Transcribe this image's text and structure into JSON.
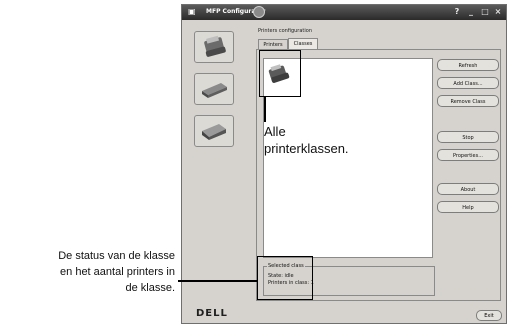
{
  "window": {
    "title": "MFP Configurator",
    "controls": [
      "?",
      "_",
      "□",
      "×"
    ]
  },
  "group": {
    "label": "Printers configuration"
  },
  "tabs": [
    {
      "label": "Printers",
      "active": false
    },
    {
      "label": "Classes",
      "active": true
    }
  ],
  "side_buttons": [
    {
      "icon": "printer-icon"
    },
    {
      "icon": "scanner-icon"
    },
    {
      "icon": "port-icon"
    }
  ],
  "buttons": {
    "refresh": "Refresh",
    "add_class": "Add Class...",
    "remove_class": "Remove Class",
    "stop": "Stop",
    "properties": "Properties...",
    "about": "About",
    "help": "Help",
    "exit": "Exit"
  },
  "selected_class": {
    "title": "Selected class",
    "state": "State: idle",
    "count": "Printers in class: 1"
  },
  "logo": "DELL",
  "callouts": {
    "classes": "Alle printerklassen.",
    "classes_line1": "Alle",
    "classes_line2": "printerklassen.",
    "status_line1": "De status van de klasse",
    "status_line2": "en het aantal printers in",
    "status_line3": "de klasse."
  }
}
